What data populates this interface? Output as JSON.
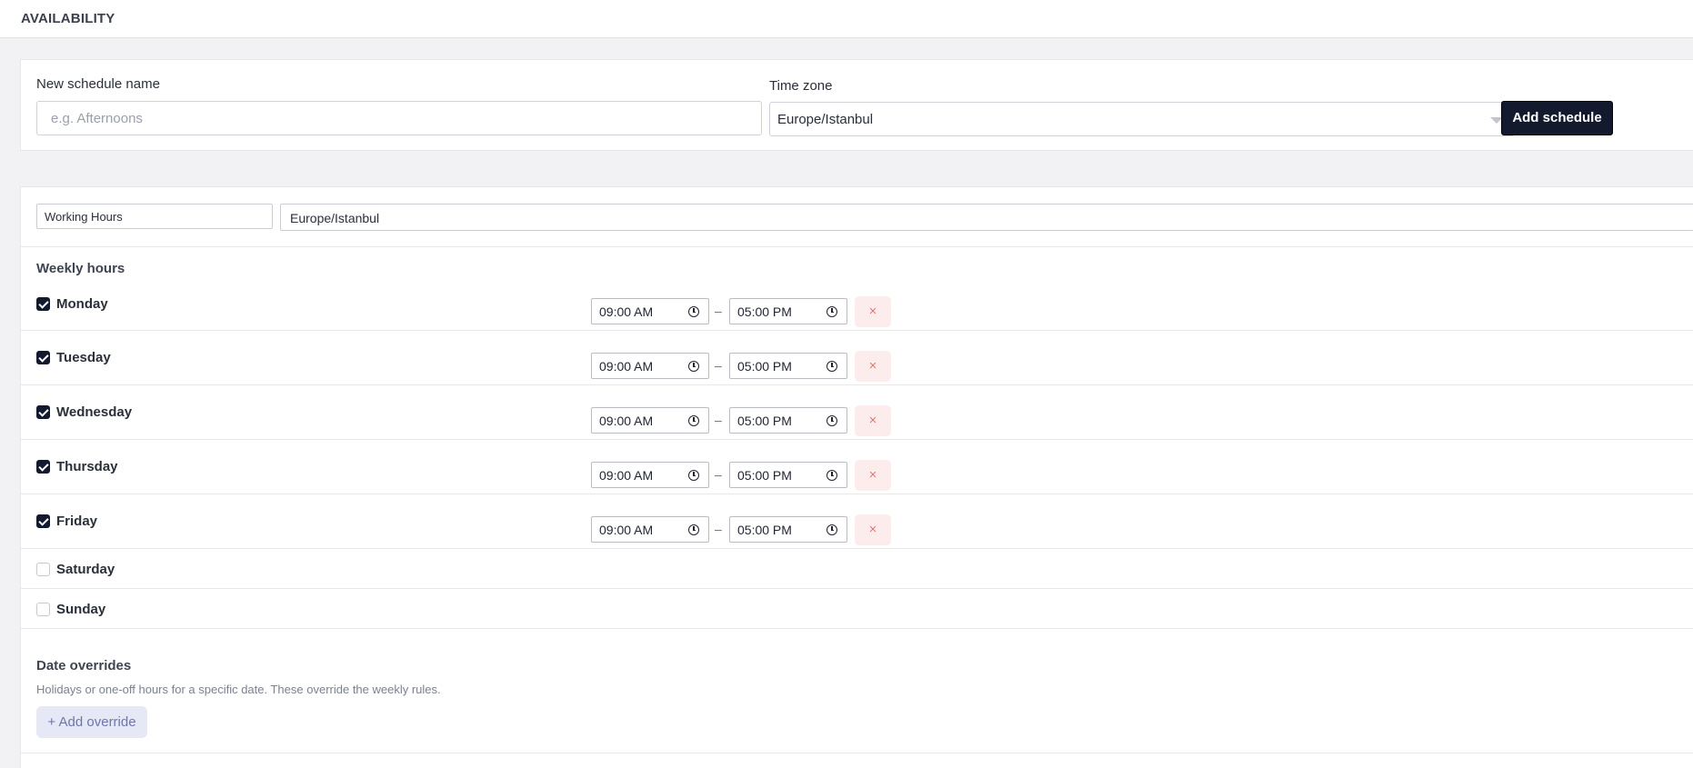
{
  "header": {
    "title": "AVAILABILITY"
  },
  "new_schedule": {
    "name_label": "New schedule name",
    "name_placeholder": "e.g. Afternoons",
    "name_value": "",
    "timezone_label": "Time zone",
    "timezone_value": "Europe/Istanbul",
    "add_label": "Add schedule"
  },
  "schedule": {
    "name": "Working Hours",
    "timezone": "Europe/Istanbul",
    "weekly_title": "Weekly hours",
    "days": [
      {
        "label": "Monday",
        "enabled": true,
        "start": "09:00 AM",
        "end": "05:00 PM"
      },
      {
        "label": "Tuesday",
        "enabled": true,
        "start": "09:00 AM",
        "end": "05:00 PM"
      },
      {
        "label": "Wednesday",
        "enabled": true,
        "start": "09:00 AM",
        "end": "05:00 PM"
      },
      {
        "label": "Thursday",
        "enabled": true,
        "start": "09:00 AM",
        "end": "05:00 PM"
      },
      {
        "label": "Friday",
        "enabled": true,
        "start": "09:00 AM",
        "end": "05:00 PM"
      },
      {
        "label": "Saturday",
        "enabled": false
      },
      {
        "label": "Sunday",
        "enabled": false
      }
    ],
    "range_separator": "–",
    "remove_glyph": "×",
    "overrides_title": "Date overrides",
    "overrides_desc": "Holidays or one-off hours for a specific date. These override the weekly rules.",
    "add_override_label": "+ Add override"
  },
  "colors": {
    "primary": "#141a2e",
    "remove_bg": "#fdecec",
    "remove_fg": "#e07a72",
    "override_bg": "#e6e8f6",
    "override_fg": "#6e76ac"
  }
}
